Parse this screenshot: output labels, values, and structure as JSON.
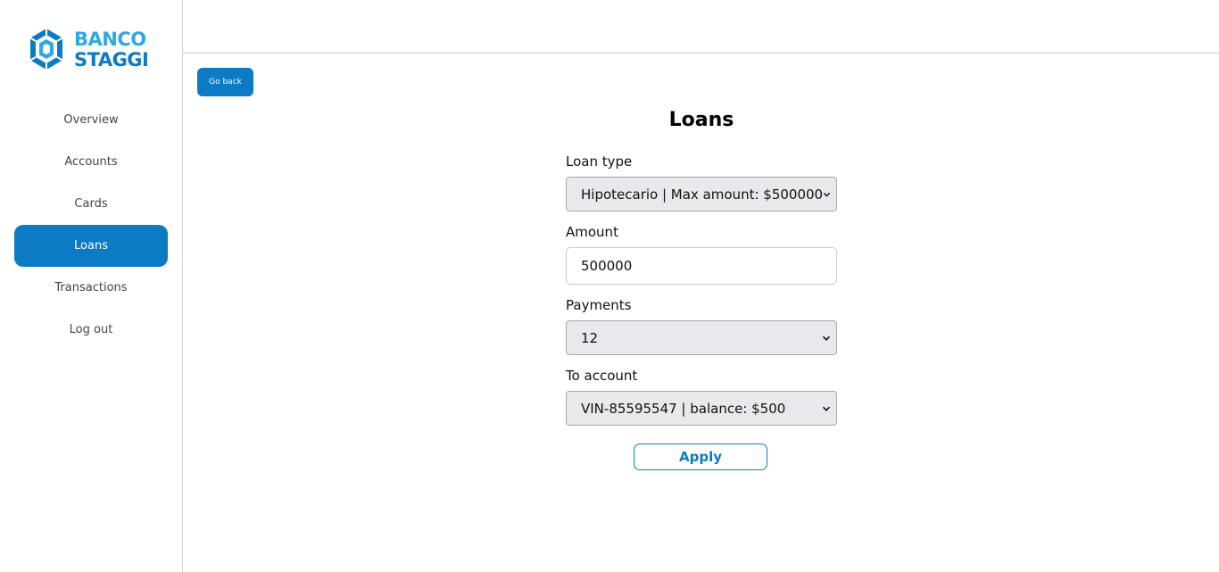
{
  "brand": {
    "line1": "BANCO",
    "line2": "STAGGI",
    "color_light": "#2fa8e0",
    "color_dark": "#0c7bc4"
  },
  "sidebar": {
    "items": [
      {
        "label": "Overview",
        "active": false
      },
      {
        "label": "Accounts",
        "active": false
      },
      {
        "label": "Cards",
        "active": false
      },
      {
        "label": "Loans",
        "active": true
      },
      {
        "label": "Transactions",
        "active": false
      },
      {
        "label": "Log out",
        "active": false
      }
    ]
  },
  "toolbar": {
    "go_back_label": "Go back"
  },
  "main": {
    "title": "Loans",
    "loan_type": {
      "label": "Loan type",
      "value": "Hipotecario | Max amount: $500000",
      "icon": "chevron-down-icon"
    },
    "amount": {
      "label": "Amount",
      "value": "500000"
    },
    "payments": {
      "label": "Payments",
      "value": "12",
      "icon": "chevron-down-icon"
    },
    "to_account": {
      "label": "To account",
      "value": "VIN-85595547 | balance: $500",
      "icon": "chevron-down-icon"
    },
    "apply_label": "Apply"
  },
  "colors": {
    "accent": "#0c7bc4",
    "select_bg": "#e9e9ed"
  }
}
